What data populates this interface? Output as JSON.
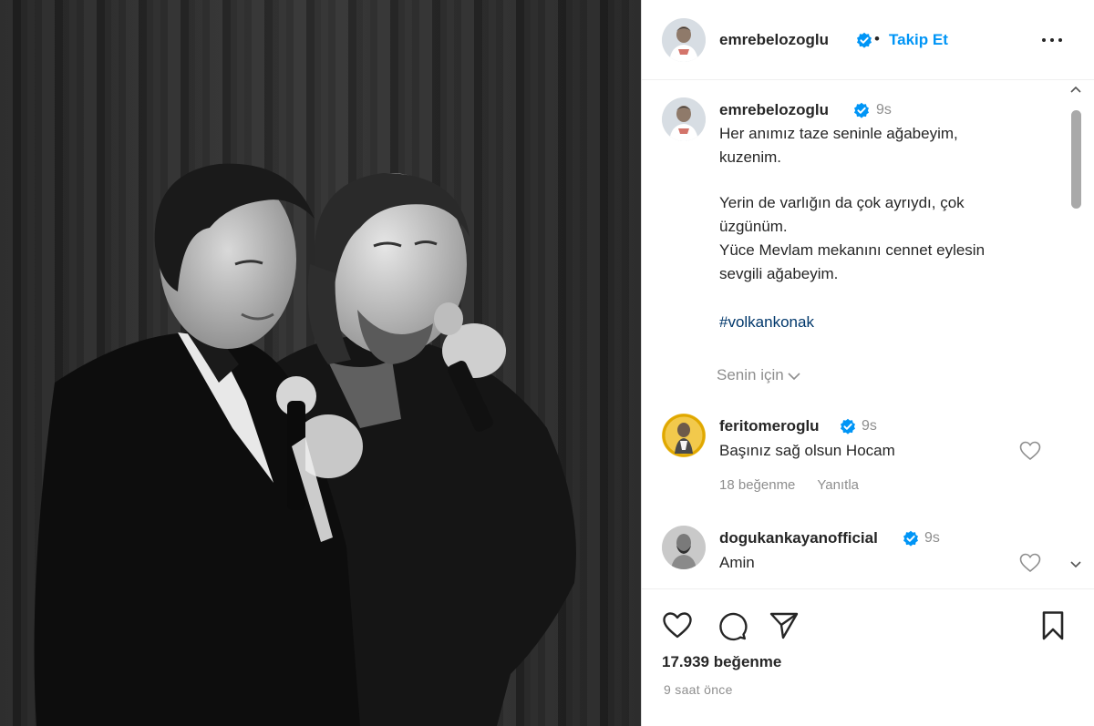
{
  "post": {
    "author": "emrebelozoglu",
    "follow_separator": "•",
    "follow_label": "Takip Et",
    "caption_time": "9s",
    "caption_lines": [
      "Her anımız taze seninle ağabeyim,",
      "kuzenim.",
      "",
      "Yerin de varlığın da çok ayrıydı, çok",
      "üzgünüm.",
      "Yüce Mevlam mekanını cennet eylesin",
      "sevgili ağabeyim."
    ],
    "hashtag": "#volkankonak",
    "for_you_label": "Senin için",
    "likes": "17.939 beğenme",
    "time_ago": "9 saat önce"
  },
  "comments": [
    {
      "user": "feritomeroglu",
      "time": "9s",
      "text": "Başınız sağ olsun Hocam",
      "likes": "18 beğenme",
      "reply": "Yanıtla"
    },
    {
      "user": "dogukankayanofficial",
      "time": "9s",
      "text": "Amin"
    }
  ],
  "icons": {
    "verified": "verified-badge-icon",
    "more": "more-options-icon",
    "like": "heart-icon",
    "comment": "comment-icon",
    "share": "share-icon",
    "save": "bookmark-icon"
  },
  "colors": {
    "accent": "#0095f6",
    "verified": "#0095f6",
    "hashtag": "#00376b",
    "muted": "#8e8e8e",
    "text": "#262626"
  }
}
